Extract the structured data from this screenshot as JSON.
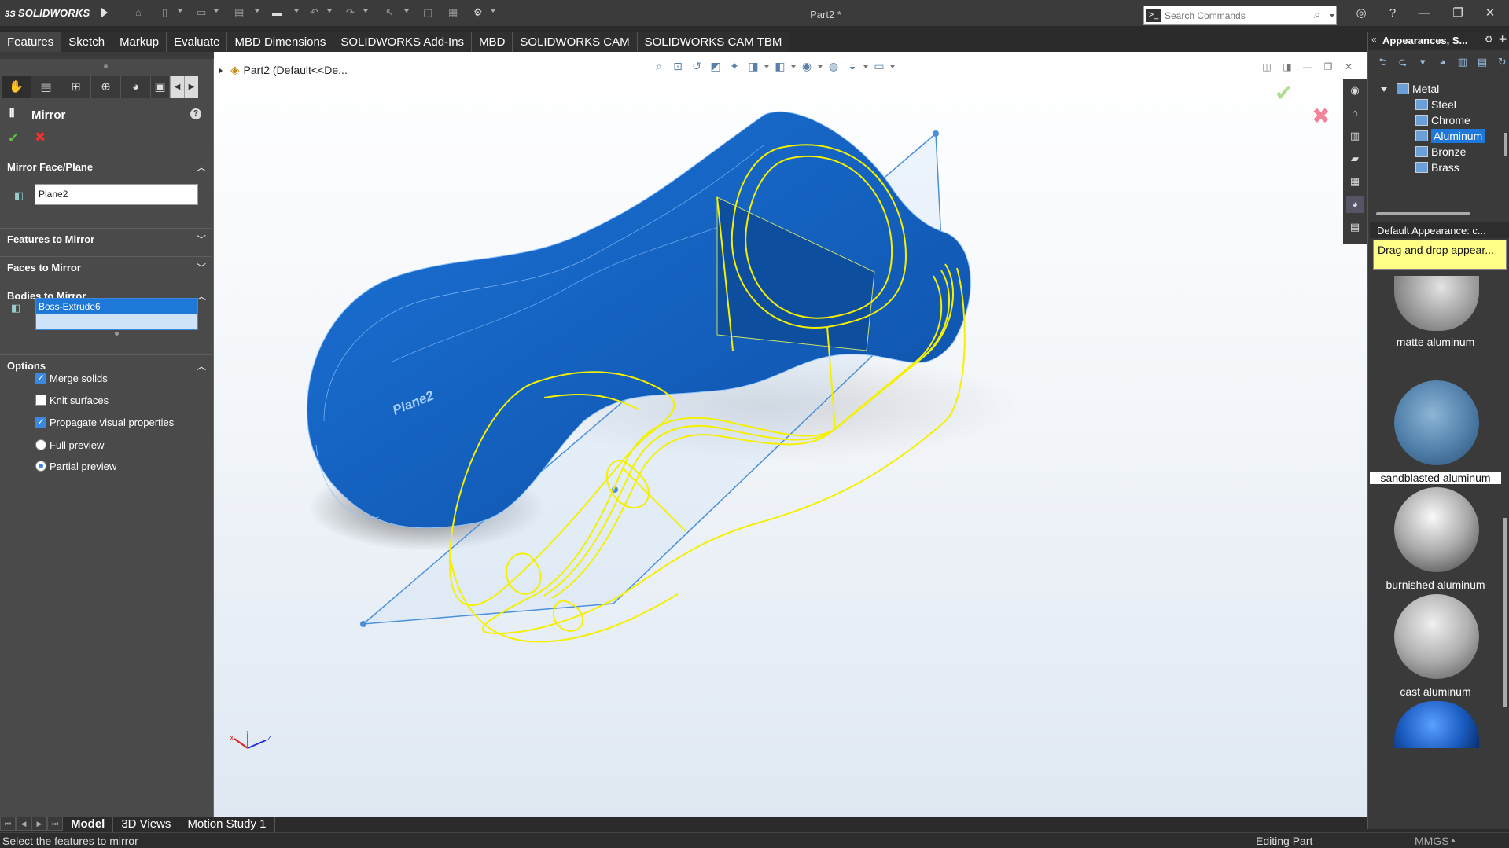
{
  "app": {
    "brand": "SOLIDWORKS",
    "document_title": "Part2 *"
  },
  "search": {
    "placeholder": "Search Commands"
  },
  "command_tabs": [
    "Features",
    "Sketch",
    "Markup",
    "Evaluate",
    "MBD Dimensions",
    "SOLIDWORKS Add-Ins",
    "MBD",
    "SOLIDWORKS CAM",
    "SOLIDWORKS CAM TBM"
  ],
  "property_manager": {
    "title": "Mirror",
    "help": "?",
    "sections": {
      "mirror_face_plane": "Mirror Face/Plane",
      "features_to_mirror": "Features to Mirror",
      "faces_to_mirror": "Faces to Mirror",
      "bodies_to_mirror": "Bodies to Mirror",
      "options": "Options"
    },
    "plane_value": "Plane2",
    "body_value": "Boss-Extrude6",
    "options": {
      "merge_solids": {
        "label": "Merge solids",
        "checked": true
      },
      "knit_surfaces": {
        "label": "Knit surfaces",
        "checked": false
      },
      "propagate": {
        "label": "Propagate visual properties",
        "checked": true
      },
      "full_preview": {
        "label": "Full preview",
        "selected": false
      },
      "partial_preview": {
        "label": "Partial preview",
        "selected": true
      }
    }
  },
  "viewport": {
    "tree_breadcrumb": "Part2  (Default<<De...",
    "plane_label": "Plane2",
    "triad": {
      "x": "X",
      "y": "Y",
      "z": "Z"
    },
    "colors": {
      "body": "#1565c8",
      "preview": "#f4f000",
      "plane": "#4a90d9"
    }
  },
  "appearances": {
    "title": "Appearances, S...",
    "tree": [
      {
        "label": "Metal",
        "level": 0
      },
      {
        "label": "Steel",
        "level": 1
      },
      {
        "label": "Chrome",
        "level": 1
      },
      {
        "label": "Aluminum",
        "level": 1,
        "selected": true
      },
      {
        "label": "Bronze",
        "level": 1
      },
      {
        "label": "Brass",
        "level": 1
      }
    ],
    "default_bar": "Default Appearance: c...",
    "tooltip": "Drag and drop appear...",
    "swatches": [
      {
        "label": "matte aluminum",
        "selected": false
      },
      {
        "label": "sandblasted aluminum",
        "selected": true
      },
      {
        "label": "burnished aluminum",
        "selected": false
      },
      {
        "label": "cast aluminum",
        "selected": false
      },
      {
        "label": "",
        "selected": false
      }
    ]
  },
  "bottom_tabs": [
    "Model",
    "3D Views",
    "Motion Study 1"
  ],
  "status": {
    "message": "Select the features to mirror",
    "mode": "Editing Part",
    "units": "MMGS"
  }
}
